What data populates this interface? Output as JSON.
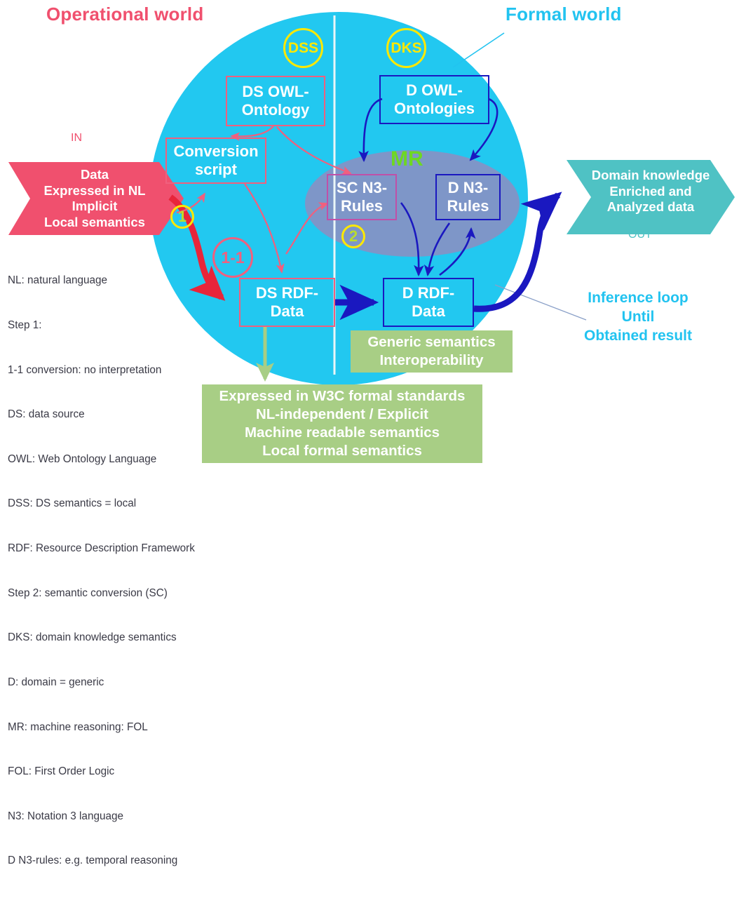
{
  "diagram": {
    "title_left": "Operational world",
    "title_right": "Formal world",
    "mr_label": "MR"
  },
  "colors": {
    "circle_cyan": "#22C8F0",
    "ellipse_slate": "#7E96C8",
    "pink": "#F0607E",
    "crimson": "#E8253A",
    "deep_blue": "#1A18C0",
    "magenta": "#C050A8",
    "yellow": "#FFE800",
    "green_box": "#A8CE85",
    "green_arrow": "#A8CE85",
    "mr_green": "#6ED822",
    "teal": "#4FC2C4",
    "text_dark": "#3A3A46"
  },
  "in_banner": {
    "word": "IN",
    "lines": [
      "Data",
      "Expressed in NL",
      "Implicit",
      "Local semantics"
    ]
  },
  "out_banner": {
    "word": "OUT",
    "lines": [
      "Domain knowledge",
      "Enriched and",
      "Analyzed data"
    ]
  },
  "badges": {
    "dss": "DSS",
    "dks": "DKS",
    "step1": "1",
    "step2": "2",
    "one_to_one": "1-1"
  },
  "nodes": {
    "ds_owl_ontology": "DS OWL-\nOntology",
    "conversion_script": "Conversion\nscript",
    "ds_rdf_data": "DS RDF-\nData",
    "d_owl_ontologies": "D OWL-\nOntologies",
    "sc_n3_rules": "SC N3-\nRules",
    "d_n3_rules": "D N3-\nRules",
    "d_rdf_data": "D RDF-\nData"
  },
  "green_boxes": {
    "generic": [
      "Generic semantics",
      "Interoperability"
    ],
    "w3c": [
      "Expressed in W3C formal standards",
      "NL-independent / Explicit",
      "Machine readable semantics",
      "Local formal semantics"
    ]
  },
  "inference_loop": [
    "Inference loop",
    "Until",
    "Obtained result"
  ],
  "legend": {
    "lines": [
      "NL: natural language",
      "Step 1:",
      "1-1 conversion: no interpretation",
      "DS: data source",
      "OWL: Web Ontology Language",
      "DSS: DS semantics = local",
      "RDF: Resource Description Framework",
      "Step 2: semantic conversion (SC)",
      "DKS: domain knowledge semantics",
      "D: domain = generic",
      "MR: machine reasoning: FOL",
      "FOL: First Order Logic",
      "N3: Notation 3 language",
      "D N3-rules: e.g. temporal reasoning"
    ]
  }
}
